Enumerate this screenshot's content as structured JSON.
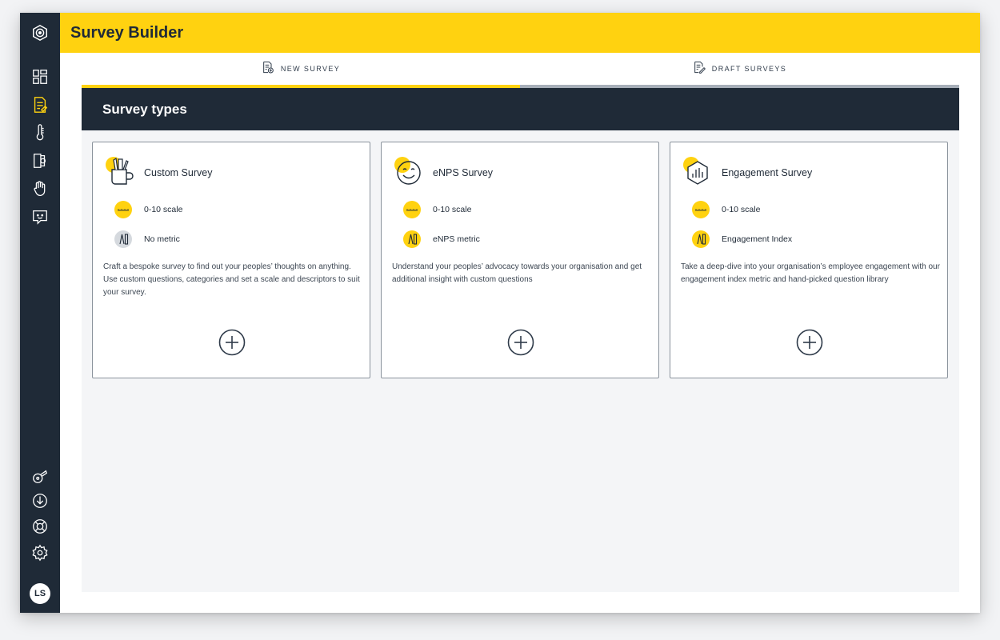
{
  "app": {
    "title": "Survey Builder",
    "brand_color": "#ffd210",
    "dark_color": "#1f2a37"
  },
  "sidebar": {
    "top_items": [
      {
        "icon": "logo-icon"
      },
      {
        "icon": "dashboard-icon"
      },
      {
        "icon": "survey-icon",
        "active": true
      },
      {
        "icon": "thermometer-icon"
      },
      {
        "icon": "door-exit-icon"
      },
      {
        "icon": "hand-wave-icon"
      },
      {
        "icon": "feedback-chat-icon"
      }
    ],
    "bottom_items": [
      {
        "icon": "whistle-icon"
      },
      {
        "icon": "download-icon"
      },
      {
        "icon": "help-lifebuoy-icon"
      },
      {
        "icon": "settings-gear-icon"
      }
    ],
    "avatar_initials": "LS"
  },
  "tabs": [
    {
      "label": "NEW SURVEY",
      "active": true
    },
    {
      "label": "DRAFT SURVEYS",
      "active": false
    }
  ],
  "section": {
    "title": "Survey types"
  },
  "cards": [
    {
      "title": "Custom Survey",
      "icon": "pencil-cup-icon",
      "scale_label": "0-10 scale",
      "metric_label": "No metric",
      "metric_active": false,
      "description": "Craft a bespoke survey to find out your peoples’ thoughts on anything. Use custom questions, categories and set a scale and descriptors to suit your survey."
    },
    {
      "title": "eNPS Survey",
      "icon": "smiley-face-icon",
      "scale_label": "0-10 scale",
      "metric_label": "eNPS metric",
      "metric_active": true,
      "description": "Understand your peoples’ advocacy towards your organisation and get additional insight with custom questions"
    },
    {
      "title": "Engagement Survey",
      "icon": "hexagon-chart-icon",
      "scale_label": "0-10 scale",
      "metric_label": "Engagement Index",
      "metric_active": true,
      "description": "Take a deep-dive into your organisation’s employee engagement with our engagement index metric and hand-picked question library"
    }
  ]
}
